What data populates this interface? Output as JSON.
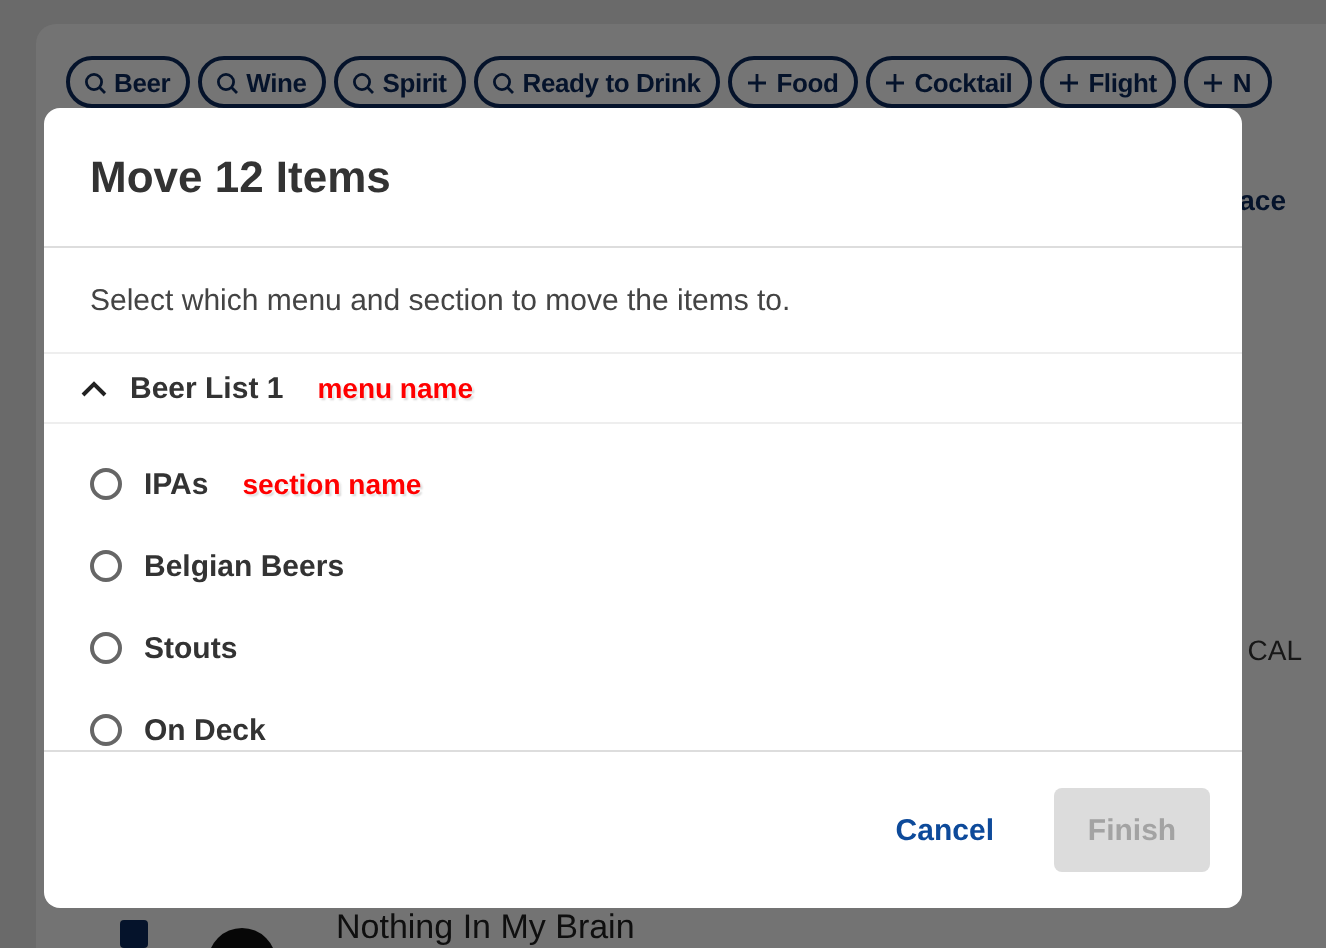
{
  "background": {
    "filter_chips": [
      {
        "kind": "search",
        "label": "Beer"
      },
      {
        "kind": "search",
        "label": "Wine"
      },
      {
        "kind": "search",
        "label": "Spirit"
      },
      {
        "kind": "search",
        "label": "Ready to Drink"
      },
      {
        "kind": "add",
        "label": "Food"
      },
      {
        "kind": "add",
        "label": "Cocktail"
      },
      {
        "kind": "add",
        "label": "Flight"
      },
      {
        "kind": "add",
        "label": "N"
      }
    ],
    "link_fragment": "ace",
    "item_fragment": "CAL",
    "item_title": "Nothing In My Brain",
    "item_checked": true
  },
  "dialog": {
    "title": "Move 12 Items",
    "description": "Select which menu and section to move the items to.",
    "menu": {
      "name": "Beer List 1",
      "expanded": true,
      "annotation": "menu name"
    },
    "sections": [
      {
        "name": "IPAs",
        "selected": false,
        "annotation": "section name"
      },
      {
        "name": "Belgian Beers",
        "selected": false
      },
      {
        "name": "Stouts",
        "selected": false
      },
      {
        "name": "On Deck",
        "selected": false
      }
    ],
    "buttons": {
      "cancel": "Cancel",
      "finish": "Finish",
      "finish_disabled": true
    }
  }
}
